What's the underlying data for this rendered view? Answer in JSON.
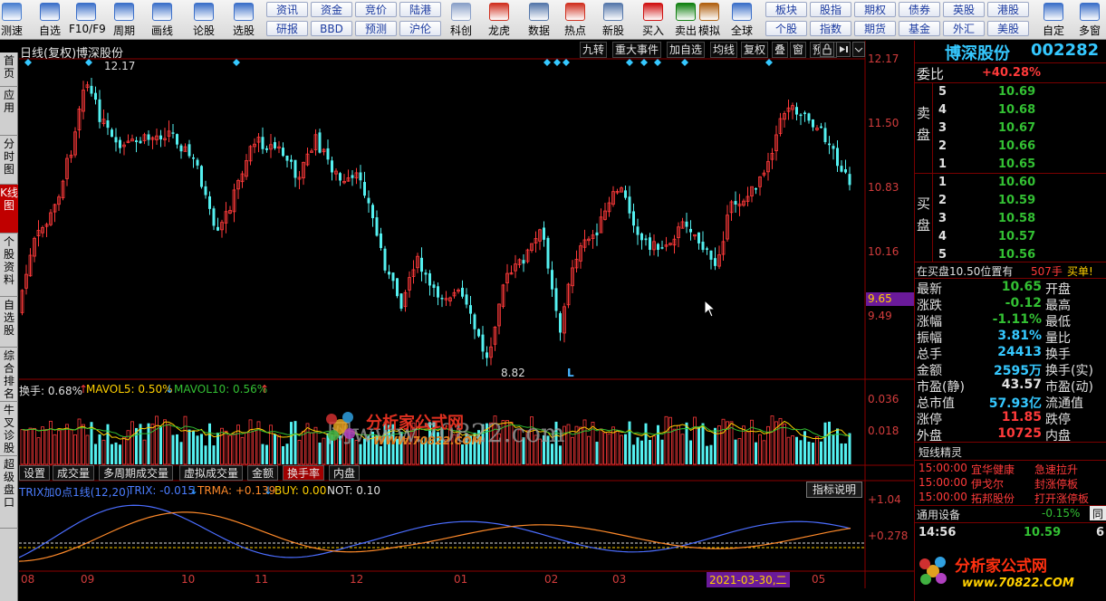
{
  "toolbar": {
    "buttons": [
      {
        "label": "测速",
        "icon": "speedometer-icon",
        "color": "#4a7fd0"
      },
      {
        "label": "自选",
        "icon": "star-icon",
        "color": "#3b6fc9"
      },
      {
        "label": "F10/F9",
        "icon": "document-icon",
        "color": "#3b6fc9"
      },
      {
        "label": "周期",
        "icon": "clock-icon",
        "color": "#3b6fc9"
      },
      {
        "label": "画线",
        "icon": "pencil-icon",
        "color": "#3b6fc9"
      },
      {
        "label": "论股",
        "icon": "chat-icon",
        "color": "#3b6fc9"
      },
      {
        "label": "选股",
        "icon": "chart-search-icon",
        "color": "#3b6fc9"
      },
      {
        "label": "科创",
        "icon": "kc-chart-icon",
        "color": "#8aa0c8"
      },
      {
        "label": "龙虎",
        "icon": "dragon-icon",
        "color": "#d03020"
      },
      {
        "label": "数据",
        "icon": "pe-icon",
        "color": "#5577aa"
      },
      {
        "label": "热点",
        "icon": "hot-icon",
        "color": "#d03020"
      },
      {
        "label": "新股",
        "icon": "ipo-icon",
        "color": "#5577aa"
      },
      {
        "label": "买入",
        "icon": "buy-icon",
        "color": "#d01010"
      },
      {
        "label": "卖出",
        "icon": "sell-icon",
        "color": "#108010"
      },
      {
        "label": "模拟",
        "icon": "gavel-icon",
        "color": "#b06010"
      },
      {
        "label": "全球",
        "icon": "globe-icon",
        "color": "#3b6fc9"
      },
      {
        "label": "自定",
        "icon": "custom-icon",
        "color": "#3b6fc9"
      },
      {
        "label": "多窗",
        "icon": "window-icon",
        "color": "#3b6fc9"
      }
    ],
    "quick_row1": [
      "资讯",
      "资金",
      "竞价",
      "陆港"
    ],
    "quick_row2": [
      "研报",
      "BBD",
      "预测",
      "沪伦"
    ],
    "quick_row3": [
      "板块",
      "股指",
      "期权",
      "债券",
      "英股",
      "港股"
    ],
    "quick_row4": [
      "个股",
      "指数",
      "期货",
      "基金",
      "外汇",
      "美股"
    ]
  },
  "left_tabs": [
    {
      "label": "首页",
      "active": false
    },
    {
      "label": "应用",
      "active": false
    },
    {
      "label": "分时图",
      "active": false
    },
    {
      "label": "K线图",
      "active": true
    },
    {
      "label": "个股资料",
      "active": false
    },
    {
      "label": "自选股",
      "active": false
    },
    {
      "label": "综合排名",
      "active": false
    },
    {
      "label": "牛叉诊股",
      "active": false
    },
    {
      "label": "超级盘口",
      "active": false
    }
  ],
  "chart": {
    "title": "日线(复权)",
    "stock_name": "博深股份",
    "menu": [
      "九转",
      "重大事件",
      "加自选",
      "均线",
      "复权",
      "叠",
      "窗",
      "预测"
    ],
    "price_axis": [
      "12.17",
      "11.50",
      "10.83",
      "10.16",
      "9.49"
    ],
    "current_price_tag": "9.65",
    "high_label": "12.17",
    "low_label": "8.82",
    "marker_L": "L",
    "volume": {
      "label": "换手: 0.68%",
      "mavol5": "MAVOL5: 0.50%",
      "mavol10": "MAVOL10: 0.56%",
      "axis": [
        "0.036",
        "0.018"
      ]
    },
    "tabs": [
      "设置",
      "成交量",
      "多周期成交量",
      "虚拟成交量",
      "金额",
      "换手率",
      "内盘"
    ],
    "active_tab": "换手率",
    "indicator": {
      "name": "TRIX加0点1线(12,20)",
      "trix": "TRIX: -0.015",
      "trma": "TRMA: +0.139",
      "buy": "BUY: 0.00",
      "not": "NOT: 0.10",
      "help_button": "指标说明",
      "axis": [
        "+1.04",
        "+0.278"
      ]
    },
    "date_axis": [
      "08",
      "09",
      "10",
      "11",
      "12",
      "01",
      "02",
      "03",
      "05"
    ],
    "date_highlight": "2021-03-30,二",
    "watermark": "网www.70822.com",
    "watermark_logo": "分析家公式网 WWW.70822.COM"
  },
  "quote": {
    "name": "博深股份",
    "code": "002282",
    "weibi_label": "委比",
    "weibi": "+40.28%",
    "sell_label": "卖盘",
    "buy_label": "买盘",
    "asks": [
      {
        "level": "5",
        "price": "10.69"
      },
      {
        "level": "4",
        "price": "10.68"
      },
      {
        "level": "3",
        "price": "10.67"
      },
      {
        "level": "2",
        "price": "10.66"
      },
      {
        "level": "1",
        "price": "10.65"
      }
    ],
    "bids": [
      {
        "level": "1",
        "price": "10.60"
      },
      {
        "level": "2",
        "price": "10.59"
      },
      {
        "level": "3",
        "price": "10.58"
      },
      {
        "level": "4",
        "price": "10.57"
      },
      {
        "level": "5",
        "price": "10.56"
      }
    ],
    "notice": "在买盘10.50位置有",
    "notice_qty": "507手",
    "notice_tag": "买单!",
    "stats": [
      {
        "k1": "最新",
        "v1": "10.65",
        "k2": "开盘"
      },
      {
        "k1": "涨跌",
        "v1": "-0.12",
        "k2": "最高"
      },
      {
        "k1": "涨幅",
        "v1": "-1.11%",
        "k2": "最低"
      },
      {
        "k1": "振幅",
        "v1": "3.81%",
        "k2": "量比"
      },
      {
        "k1": "总手",
        "v1": "24413",
        "k2": "换手"
      },
      {
        "k1": "金额",
        "v1": "2595万",
        "k2": "换手(实)"
      },
      {
        "k1": "市盈(静)",
        "v1": "43.57",
        "k2": "市盈(动)"
      },
      {
        "k1": "总市值",
        "v1": "57.93亿",
        "k2": "流通值"
      },
      {
        "k1": "涨停",
        "v1": "11.85",
        "k2": "跌停"
      },
      {
        "k1": "外盘",
        "v1": "10725",
        "k2": "内盘"
      }
    ],
    "elf_title": "短线精灵",
    "elf": [
      {
        "time": "15:00:00",
        "name": "宜华健康",
        "event": "急速拉升"
      },
      {
        "time": "15:00:00",
        "name": "伊戈尔",
        "event": "封涨停板"
      },
      {
        "time": "15:00:00",
        "name": "拓邦股份",
        "event": "打开涨停板"
      }
    ],
    "sector": "通用设备",
    "sector_change": "-0.15%",
    "sector_tag": "同",
    "tick_time": "14:56",
    "tick_price": "10.59",
    "tick_qty": "6"
  }
}
